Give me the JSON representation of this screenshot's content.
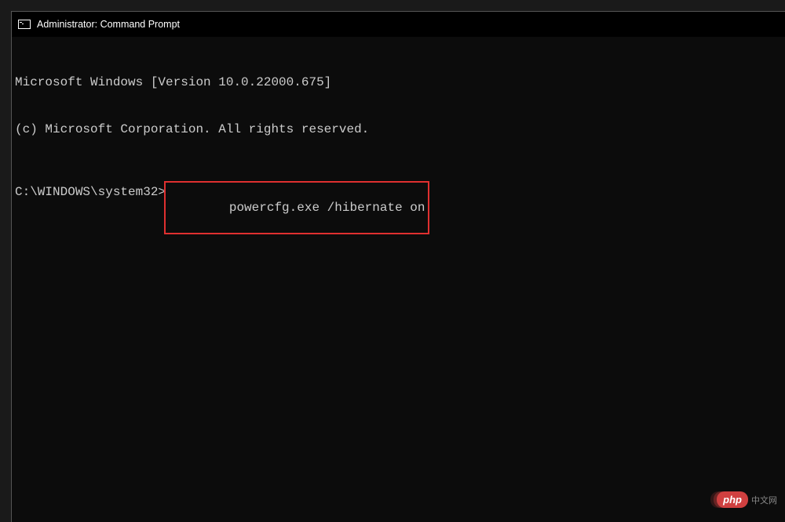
{
  "titlebar": {
    "title": "Administrator: Command Prompt"
  },
  "terminal": {
    "line1": "Microsoft Windows [Version 10.0.22000.675]",
    "line2": "(c) Microsoft Corporation. All rights reserved.",
    "prompt": "C:\\WINDOWS\\system32>",
    "command": "powercfg.exe /hibernate on"
  },
  "watermark": {
    "badge": "php",
    "text": "中文网"
  }
}
